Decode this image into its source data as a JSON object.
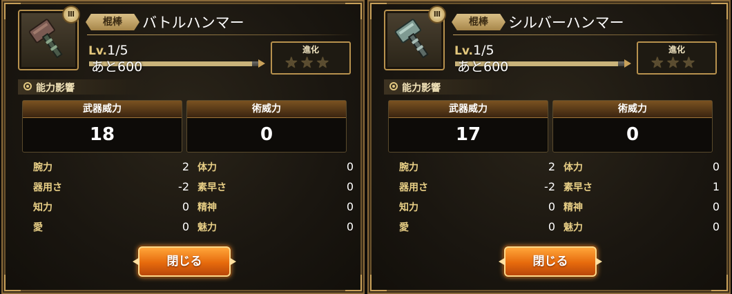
{
  "colors": {
    "accent_gold": "#c9a15a",
    "stat_label": "#e8cf86",
    "button_orange": "#e66a0c"
  },
  "panels": [
    {
      "rank_badge": "Ⅲ",
      "weapon_icon": "hammer-icon",
      "category": "棍棒",
      "name": "バトルハンマー",
      "level_label": "Lv.",
      "level": "1/5",
      "exp_text": "あと600",
      "exp_fraction": 0.95,
      "evolution": {
        "title": "進化",
        "stars_filled": 0,
        "stars_total": 3
      },
      "section_title": "能力影響",
      "weapon_power": {
        "label": "武器威力",
        "value": "18"
      },
      "skill_power": {
        "label": "術威力",
        "value": "0"
      },
      "stats": [
        {
          "label": "腕力",
          "value": "2"
        },
        {
          "label": "器用さ",
          "value": "-2"
        },
        {
          "label": "知力",
          "value": "0"
        },
        {
          "label": "愛",
          "value": "0"
        },
        {
          "label": "体力",
          "value": "0"
        },
        {
          "label": "素早さ",
          "value": "0"
        },
        {
          "label": "精神",
          "value": "0"
        },
        {
          "label": "魅力",
          "value": "0"
        }
      ],
      "close_label": "閉じる"
    },
    {
      "rank_badge": "Ⅲ",
      "weapon_icon": "hammer-icon",
      "category": "棍棒",
      "name": "シルバーハンマー",
      "level_label": "Lv.",
      "level": "1/5",
      "exp_text": "あと600",
      "exp_fraction": 0.95,
      "evolution": {
        "title": "進化",
        "stars_filled": 0,
        "stars_total": 3
      },
      "section_title": "能力影響",
      "weapon_power": {
        "label": "武器威力",
        "value": "17"
      },
      "skill_power": {
        "label": "術威力",
        "value": "0"
      },
      "stats": [
        {
          "label": "腕力",
          "value": "2"
        },
        {
          "label": "器用さ",
          "value": "-2"
        },
        {
          "label": "知力",
          "value": "0"
        },
        {
          "label": "愛",
          "value": "0"
        },
        {
          "label": "体力",
          "value": "0"
        },
        {
          "label": "素早さ",
          "value": "1"
        },
        {
          "label": "精神",
          "value": "0"
        },
        {
          "label": "魅力",
          "value": "0"
        }
      ],
      "close_label": "閉じる"
    }
  ]
}
